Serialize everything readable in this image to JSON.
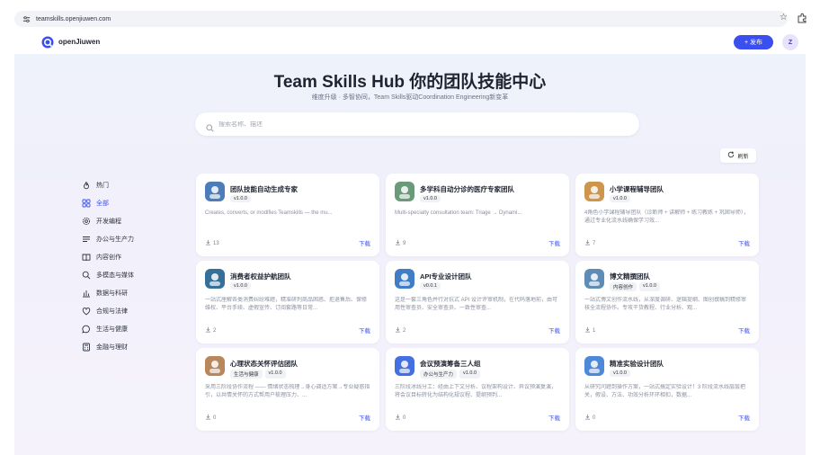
{
  "browser": {
    "url": "teamskills.openjiuwen.com"
  },
  "header": {
    "brand": "openJiuwen",
    "publish_label": "+ 发布",
    "avatar_letter": "Z"
  },
  "hero": {
    "title": "Team Skills Hub 你的团队技能中心",
    "subtitle": "维度升级 · 多智协同，Team Skills驱动Coordination Engineering新变革",
    "search_placeholder": "搜索名称、描述"
  },
  "refresh_label": "刷新",
  "sidebar": {
    "items": [
      {
        "label": "热门",
        "icon": "fire-icon"
      },
      {
        "label": "全部",
        "icon": "grid-icon",
        "active": true
      },
      {
        "label": "开发编程",
        "icon": "gear-icon"
      },
      {
        "label": "办公与生产力",
        "icon": "list-icon"
      },
      {
        "label": "内容创作",
        "icon": "book-icon"
      },
      {
        "label": "多模态与媒体",
        "icon": "search-icon"
      },
      {
        "label": "数据与科研",
        "icon": "chart-icon"
      },
      {
        "label": "合规与法律",
        "icon": "shield-icon"
      },
      {
        "label": "生活与健康",
        "icon": "chat-icon"
      },
      {
        "label": "金融与理财",
        "icon": "calculator-icon"
      }
    ]
  },
  "download_label": "下载",
  "cards": [
    {
      "title": "团队技能自动生成专家",
      "tags": [
        "v1.0.0"
      ],
      "desc": "Creates, converts, or modifies Teamskills — the mu...",
      "downloads": "13",
      "color": "#3a6fb0"
    },
    {
      "title": "多学科自动分诊的医疗专家团队",
      "tags": [
        "v1.0.0"
      ],
      "desc": "Multi-specialty consultation team: Triage → Dynami...",
      "downloads": "9",
      "color": "#5a8f6a"
    },
    {
      "title": "小学课程辅导团队",
      "tags": [
        "v1.0.0"
      ],
      "desc": "4角色小学课程辅导团队（诊断师 + 讲解师 + 练习教练 + 巩固导师），通过专业化流水线确保学习效...",
      "downloads": "7",
      "color": "#c98b3a"
    },
    {
      "title": "消费者权益护航团队",
      "tags": [
        "v1.0.0"
      ],
      "desc": "一站式厘解各类消费纠纷难题，精准研判商品困惑、拒退售后、保修维权、平台手续、虚假宣传、订阅套路等日常...",
      "downloads": "2",
      "color": "#1f5f8f"
    },
    {
      "title": "API专业设计团队",
      "tags": [
        "v0.0.1"
      ],
      "desc": "这是一套三角色并行对抗式 API 设计评审机制，在代码落地前，由可用性审查员、安全审查员、一致性审查...",
      "downloads": "2",
      "color": "#2c6fbf"
    },
    {
      "title": "博文精撰团队",
      "tags": [
        "内容创作",
        "v1.0.0"
      ],
      "desc": "一站式博文创作流水线，从深度调研、逻辑提纲、图创撰稿到精修审核全流程协作。专攻干货教程、行业分析、观...",
      "downloads": "1",
      "color": "#4d7fae"
    },
    {
      "title": "心理状态关怀评估团队",
      "tags": [
        "生活与健康",
        "v1.0.0"
      ],
      "desc": "采用三阶段协作流程 —— 情绪状态梳理→身心调适方案→专业疑惑指引，以共情关怀的方式帮用户梳理压力、...",
      "downloads": "0",
      "color": "#b07a4a"
    },
    {
      "title": "会议预演筹备三人组",
      "tags": [
        "办公与生产力",
        "v1.0.0"
      ],
      "desc": "三阶段冰线分工：经由上下文分析、议程架构设计、异议预演复演，将会议目标转化为结构化规议程、提纲预判...",
      "downloads": "0",
      "color": "#2f5fe0"
    },
    {
      "title": "精准实验设计团队",
      "tags": [
        "v1.0.0"
      ],
      "desc": "从研究问题到操作方案，一站式搞定实验设计！3 阶段流水线层层把关，假设、方法、功效分析环环相扣，数据...",
      "downloads": "0",
      "color": "#3a7bd5"
    }
  ]
}
